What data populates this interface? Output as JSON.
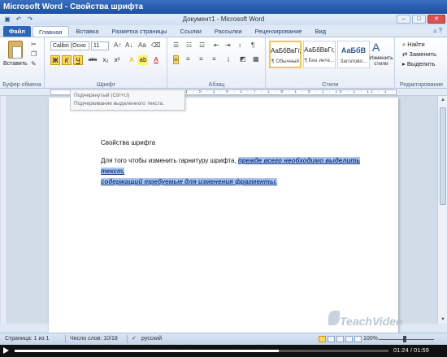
{
  "outer_title": "Microsoft Word - Свойства шрифта",
  "window": {
    "doc_title": "Документ1 - Microsoft Word",
    "controls": {
      "minimize": "–",
      "maximize": "□",
      "close": "✕"
    }
  },
  "qat": {
    "icons": [
      "save-icon",
      "undo-icon",
      "redo-icon"
    ],
    "glyphs": [
      "▣",
      "↶",
      "↷"
    ]
  },
  "tabs": [
    {
      "label": "Файл"
    },
    {
      "label": "Главная"
    },
    {
      "label": "Вставка"
    },
    {
      "label": "Разметка страницы"
    },
    {
      "label": "Ссылки"
    },
    {
      "label": "Рассылки"
    },
    {
      "label": "Рецензирование"
    },
    {
      "label": "Вид"
    }
  ],
  "ribbon": {
    "clipboard": {
      "paste_label": "Вставить",
      "group_label": "Буфер обмена"
    },
    "font": {
      "font_name": "Calibri (Осно",
      "font_size": "11",
      "buttons": [
        "Ж",
        "К",
        "Ч",
        "abc",
        "x₂",
        "x²",
        "A",
        "A"
      ],
      "group_label": "Шрифт"
    },
    "paragraph": {
      "group_label": "Абзац"
    },
    "styles": {
      "items": [
        {
          "preview": "АаБбВвГг,",
          "name": "¶ Обычный"
        },
        {
          "preview": "АаБбВвГг,",
          "name": "¶ Без инте..."
        },
        {
          "preview": "АаБбВ",
          "name": "Заголово..."
        }
      ],
      "change_label": "Изменить стили",
      "group_label": "Стили"
    },
    "editing": {
      "find": "Найти",
      "replace": "Заменить",
      "select": "Выделить",
      "group_label": "Редактирование"
    }
  },
  "tooltip": {
    "title": "Подчеркнутый (Ctrl+U)",
    "body": "Подчеркивание выделенного текста."
  },
  "ruler_text": "· 1 · 1 · 2 · 1 · 3 · 1 · 4 · 1 · 5 · 1 · 6 · 1 · 7 · 1 · 8 · 1 · 9 · 1 · 10 · 1 · 11 · 1 · 12 · 1 · 13 · 1 · 14 · 1 · 15 · 1 · 16 · 1 · 17 ·",
  "document": {
    "heading": "Свойства шрифта",
    "body_plain": "Для того чтобы изменить гарнитуру шрифта, ",
    "body_selected_1": "прежде всего необходимо выделить текст,",
    "body_selected_2": "содержащий требуемые для изменения фрагменты."
  },
  "watermark": "TeachVideo",
  "status": {
    "page": "Страница: 1 из 1",
    "words": "Число слов: 10/18",
    "language": "русский",
    "zoom": "100%"
  },
  "player": {
    "time": "01:24 / 01:59",
    "progress": 0.706
  }
}
